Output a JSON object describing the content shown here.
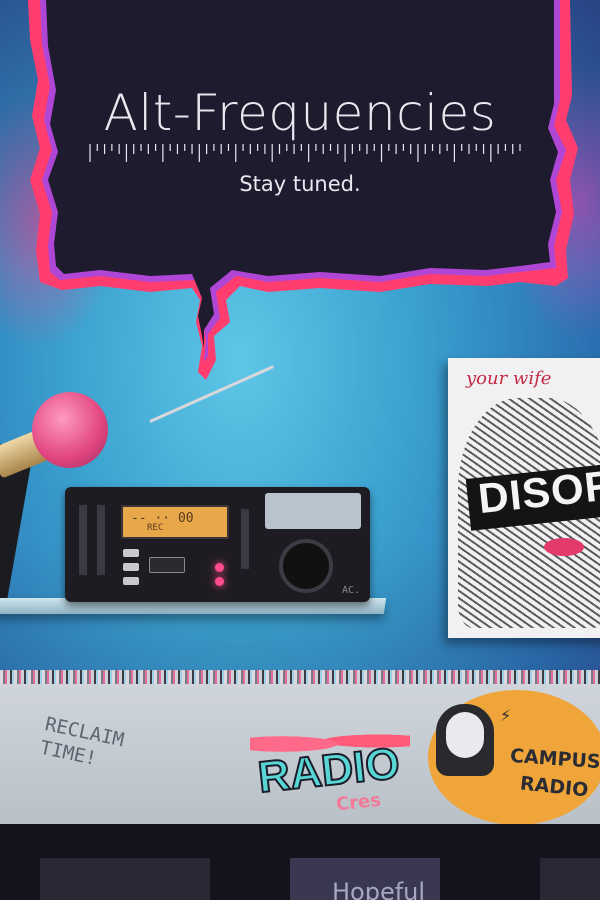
{
  "header": {
    "title": "Alt-Frequencies",
    "tagline": "Stay tuned."
  },
  "scene": {
    "radio_display": "-- ·· 00",
    "radio_rec": "REC",
    "radio_tag": "AC.",
    "poster_handwriting": "your wife",
    "poster_word": "DISOR",
    "wall_doodle": "RECLAIM\nTIME!",
    "sticker_radio": "RADIO",
    "sticker_radio_sub": "Cres",
    "sticker_campus_line1": "CAMPUS",
    "sticker_campus_line2": "RADIO",
    "bottom_partial_text": "Hopeful"
  },
  "colors": {
    "bubble_fill": "#1e1b2e",
    "bubble_edge": "#ff3d6e",
    "bubble_edge_alt": "#b046d6",
    "wall": "#3aa0cf"
  }
}
